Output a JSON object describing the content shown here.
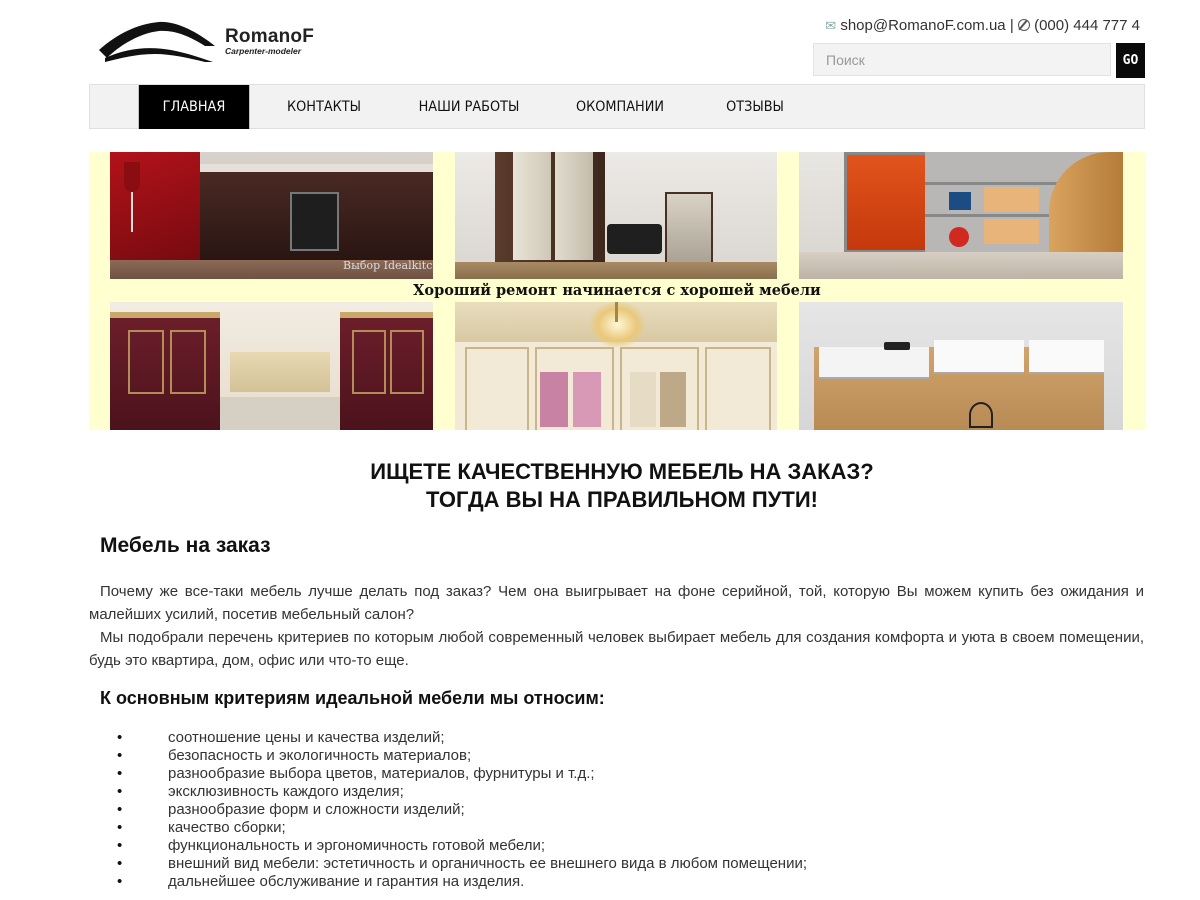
{
  "header": {
    "logo": {
      "name": "RomanoF",
      "tagline": "Carpenter-modeler"
    },
    "email_icon": "mail-icon",
    "email": "shop@RomanoF.com.ua",
    "separator": "|",
    "phone_icon": "phone-icon",
    "phone": "(000) 444 777 4",
    "search": {
      "placeholder": "Поиск",
      "button_label": "GO"
    }
  },
  "nav": {
    "items": [
      {
        "label": "ГЛАВНАЯ",
        "active": true
      },
      {
        "label": "КОНТАКТЫ",
        "active": false
      },
      {
        "label": "НАШИ РАБОТЫ",
        "active": false
      },
      {
        "label": "ОКОМПАНИИ",
        "active": false
      },
      {
        "label": "ОТЗЫВЫ",
        "active": false
      }
    ]
  },
  "banner": {
    "caption": "Хороший ремонт начинается с хорошей мебели",
    "watermark": "Выбор Idealkitc",
    "background_color": "#ffffd0"
  },
  "main": {
    "headline_line1": "ИЩЕТЕ КАЧЕСТВЕННУЮ МЕБЕЛЬ НА ЗАКАЗ?",
    "headline_line2": "ТОГДА ВЫ НА ПРАВИЛЬНОМ ПУТИ!",
    "section_title": "Мебель на заказ",
    "paragraph1": "Почему же все-таки мебель лучше делать под заказ?  Чем она выигрывает на фоне серийной, той, которую Вы можем купить без ожидания и малейших усилий,  посетив мебельный салон?",
    "paragraph2": "Мы подобрали перечень критериев по которым любой современный человек выбирает мебель для создания комфорта и уюта в своем помещении, будь это квартира, дом, офис или что-то еще.",
    "criteria_title": "К основным критериям идеальной мебели мы относим:",
    "bullet": "•",
    "criteria": [
      "соотношение цены и качества изделий;",
      "безопасность и экологичность материалов;",
      "разнообразие выбора цветов, материалов, фурнитуры и т.д.;",
      "эксклюзивность каждого изделия;",
      "разнообразие форм и сложности изделий;",
      "качество сборки;",
      "функциональность и эргономичность готовой мебели;",
      "внешний вид мебели: эстетичность и органичность ее внешнего вида в любом помещении;",
      "дальнейшее обслуживание и гарантия на изделия."
    ]
  }
}
